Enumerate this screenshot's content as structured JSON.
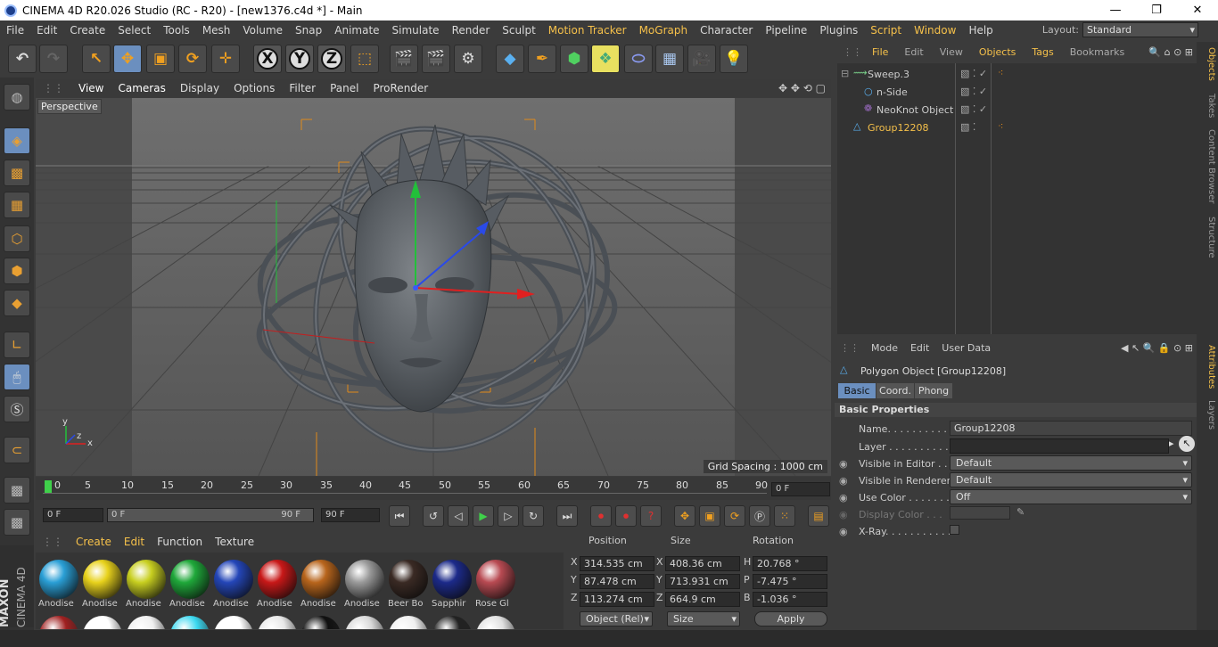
{
  "titlebar": {
    "title": "CINEMA 4D R20.026 Studio (RC - R20) - [new1376.c4d *] - Main",
    "minimize": "—",
    "maximize": "❐",
    "close": "✕"
  },
  "menubar": {
    "items": [
      "File",
      "Edit",
      "Create",
      "Select",
      "Tools",
      "Mesh",
      "Volume",
      "Snap",
      "Animate",
      "Simulate",
      "Render",
      "Sculpt",
      "Motion Tracker",
      "MoGraph",
      "Character",
      "Pipeline",
      "Plugins",
      "Script",
      "Window",
      "Help"
    ],
    "layout_label": "Layout:",
    "layout_value": "Standard"
  },
  "toolbar": {
    "x_label": "X",
    "y_label": "Y",
    "z_label": "Z"
  },
  "viewport": {
    "menu": [
      "View",
      "Cameras",
      "Display",
      "Options",
      "Filter",
      "Panel",
      "ProRender"
    ],
    "label": "Perspective",
    "grid_spacing": "Grid Spacing : 1000 cm",
    "axis_y": "y",
    "axis_z": "z",
    "axis_x": "x"
  },
  "timeline": {
    "ticks": [
      "0",
      "5",
      "10",
      "15",
      "20",
      "25",
      "30",
      "35",
      "40",
      "45",
      "50",
      "55",
      "60",
      "65",
      "70",
      "75",
      "80",
      "85",
      "90"
    ],
    "current_frame": "0 F"
  },
  "transport": {
    "start_field": "0 F",
    "range_start": "0 F",
    "range_end": "90 F",
    "end_field": "90 F"
  },
  "material_manager": {
    "menu": [
      "Create",
      "Edit",
      "Function",
      "Texture"
    ],
    "materials": [
      {
        "label": "Anodise",
        "color": "#2a9fd6"
      },
      {
        "label": "Anodise",
        "color": "#e8d21c"
      },
      {
        "label": "Anodise",
        "color": "#c8cf20"
      },
      {
        "label": "Anodise",
        "color": "#1fa83a"
      },
      {
        "label": "Anodise",
        "color": "#2446b8"
      },
      {
        "label": "Anodise",
        "color": "#c81818"
      },
      {
        "label": "Anodise",
        "color": "#b8651c"
      },
      {
        "label": "Anodise",
        "color": "#9a9a9a"
      },
      {
        "label": "Beer Bo",
        "color": "#3a2a24"
      },
      {
        "label": "Sapphir",
        "color": "#1c2a8a"
      },
      {
        "label": "Rose Gl",
        "color": "#b84a52"
      }
    ]
  },
  "coordinates": {
    "headers": {
      "position": "Position",
      "size": "Size",
      "rotation": "Rotation"
    },
    "rows": [
      {
        "axis": "X",
        "pos": "314.535 cm",
        "size_axis": "X",
        "size": "408.36 cm",
        "rot_axis": "H",
        "rot": "20.768 °"
      },
      {
        "axis": "Y",
        "pos": "87.478 cm",
        "size_axis": "Y",
        "size": "713.931 cm",
        "rot_axis": "P",
        "rot": "-7.475 °"
      },
      {
        "axis": "Z",
        "pos": "113.274 cm",
        "size_axis": "Z",
        "size": "664.9 cm",
        "rot_axis": "B",
        "rot": "-1.036 °"
      }
    ],
    "mode_dropdown": "Object (Rel)",
    "size_dropdown": "Size",
    "apply_label": "Apply"
  },
  "object_manager": {
    "menu": [
      "File",
      "Edit",
      "View",
      "Objects",
      "Tags",
      "Bookmarks"
    ],
    "objects": [
      {
        "name": "Sweep.3",
        "highlighted": false
      },
      {
        "name": "n-Side",
        "highlighted": false
      },
      {
        "name": "NeoKnot Object",
        "highlighted": false
      },
      {
        "name": "Group12208",
        "highlighted": true
      }
    ]
  },
  "side_tabs": {
    "top": [
      "Objects",
      "Takes",
      "Content Browser",
      "Structure"
    ],
    "bottom": [
      "Attributes",
      "Layers"
    ]
  },
  "attributes": {
    "menu": [
      "Mode",
      "Edit",
      "User Data"
    ],
    "object_title": "Polygon Object [Group12208]",
    "tabs": [
      "Basic",
      "Coord.",
      "Phong"
    ],
    "section": "Basic Properties",
    "props": [
      {
        "label": "Name. . . . . . . . . . . .",
        "value": "Group12208"
      },
      {
        "label": "Layer . . . . . . . . . . . .",
        "value": ""
      },
      {
        "label": "Visible in Editor . . .",
        "value": "Default"
      },
      {
        "label": "Visible in Renderer",
        "value": "Default"
      },
      {
        "label": "Use Color . . . . . . . .",
        "value": "Off"
      },
      {
        "label": "Display Color . . .",
        "value": ""
      },
      {
        "label": "X-Ray. . . . . . . . . . . .",
        "value": ""
      }
    ]
  },
  "brand": {
    "maxon": "MAXON",
    "cinema": "CINEMA 4D"
  },
  "colors": {
    "accent": "#f5c04a",
    "selection": "#6b8fbf",
    "axis_x": "#e02020",
    "axis_y": "#22c03a",
    "axis_z": "#2a4ae8"
  }
}
